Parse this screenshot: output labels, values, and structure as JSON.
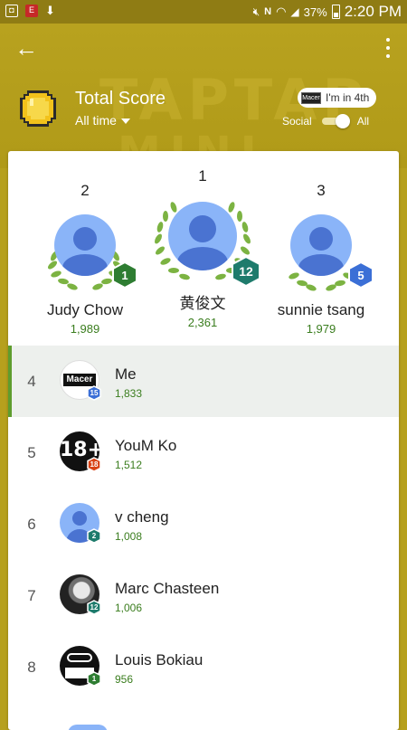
{
  "status_bar": {
    "battery": "37%",
    "time": "2:20 PM"
  },
  "header": {
    "background_text_1": "TAPTAP",
    "background_text_2": "MINI",
    "title": "Total Score",
    "period": "All time",
    "rank_pill": "I'm in 4th",
    "rank_pill_logo": "Macer",
    "toggle_left": "Social",
    "toggle_right": "All",
    "toggle_state": "All"
  },
  "podium": [
    {
      "rank": "2",
      "name": "Judy Chow",
      "score": "1,989",
      "level": "1",
      "badge_color": "#2e7d32"
    },
    {
      "rank": "1",
      "name": "黄俊文",
      "score": "2,361",
      "level": "12",
      "badge_color": "#1e7b6c"
    },
    {
      "rank": "3",
      "name": "sunnie tsang",
      "score": "1,979",
      "level": "5",
      "badge_color": "#3b6fd6"
    }
  ],
  "rows": [
    {
      "rank": "4",
      "name": "Me",
      "score": "1,833",
      "level": "15",
      "badge_color": "#3b6fd6",
      "avatar_text": "Macer",
      "highlight": true
    },
    {
      "rank": "5",
      "name": "YouM Ko",
      "score": "1,512",
      "level": "18",
      "badge_color": "#d84315",
      "avatar_text": "18+"
    },
    {
      "rank": "6",
      "name": "v cheng",
      "score": "1,008",
      "level": "2",
      "badge_color": "#1e7b6c",
      "avatar_text": ""
    },
    {
      "rank": "7",
      "name": "Marc Chasteen",
      "score": "1,006",
      "level": "12",
      "badge_color": "#1e7b6c",
      "avatar_text": ""
    },
    {
      "rank": "8",
      "name": "Louis Bokiau",
      "score": "956",
      "level": "1",
      "badge_color": "#2e7d32",
      "avatar_text": ""
    }
  ],
  "colors": {
    "brand_gold": "#b6a01d",
    "score_green": "#3a7d1e",
    "accent_green": "#5e9d2e"
  }
}
